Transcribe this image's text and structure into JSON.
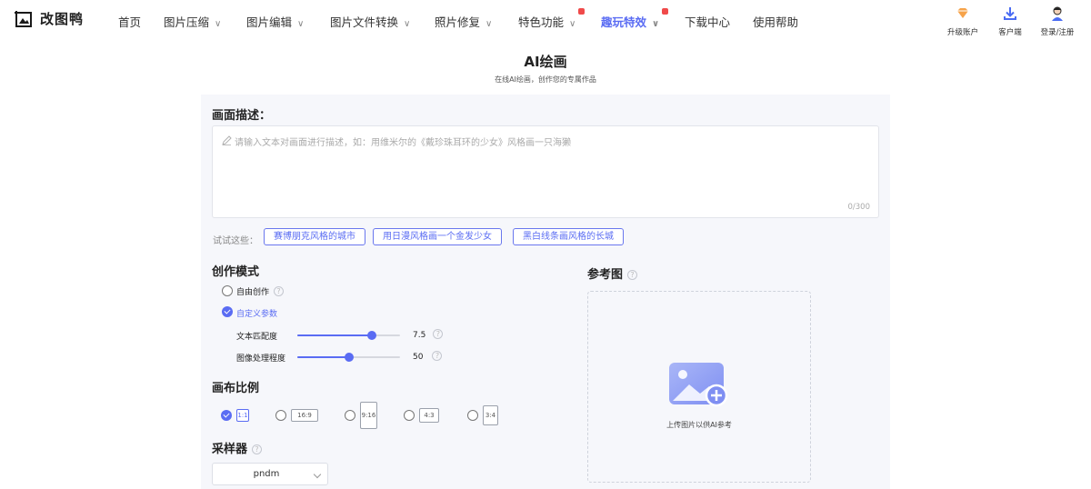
{
  "brand": {
    "name": "改图鸭"
  },
  "nav": [
    {
      "label": "首页",
      "dropdown": false,
      "active": false,
      "dot": false
    },
    {
      "label": "图片压缩",
      "dropdown": true,
      "active": false,
      "dot": false
    },
    {
      "label": "图片编辑",
      "dropdown": true,
      "active": false,
      "dot": false
    },
    {
      "label": "图片文件转换",
      "dropdown": true,
      "active": false,
      "dot": false
    },
    {
      "label": "照片修复",
      "dropdown": true,
      "active": false,
      "dot": false
    },
    {
      "label": "特色功能",
      "dropdown": true,
      "active": false,
      "dot": true
    },
    {
      "label": "趣玩特效",
      "dropdown": true,
      "active": true,
      "dot": true
    },
    {
      "label": "下载中心",
      "dropdown": false,
      "active": false,
      "dot": false
    },
    {
      "label": "使用帮助",
      "dropdown": false,
      "active": false,
      "dot": false
    }
  ],
  "tools": [
    {
      "label": "升级账户",
      "icon": "diamond-icon"
    },
    {
      "label": "客户端",
      "icon": "download-icon"
    },
    {
      "label": "登录/注册",
      "icon": "user-avatar-icon"
    }
  ],
  "page": {
    "title": "AI绘画",
    "subtitle": "在线AI绘画，创作您的专属作品"
  },
  "description": {
    "title": "画面描述：",
    "placeholder": "请输入文本对画面进行描述，如：用维米尔的《戴珍珠耳环的少女》风格画一只海獭",
    "value": "",
    "counter": "0/300"
  },
  "suggestions": {
    "label": "试试这些：",
    "chips": [
      "赛博朋克风格的城市",
      "用日漫风格画一个金发少女",
      "黑白线条画风格的长城"
    ]
  },
  "mode": {
    "title": "创作模式",
    "options": [
      {
        "label": "自由创作",
        "selected": false
      },
      {
        "label": "自定义参数",
        "selected": true
      }
    ],
    "sliders": [
      {
        "label": "文本匹配度",
        "value": "7.5",
        "fraction": 0.73
      },
      {
        "label": "图像处理程度",
        "value": "50",
        "fraction": 0.5
      }
    ]
  },
  "ratio": {
    "title": "画布比例",
    "options": [
      {
        "label": "1:1",
        "selected": true
      },
      {
        "label": "16:9",
        "selected": false
      },
      {
        "label": "9:16",
        "selected": false
      },
      {
        "label": "4:3",
        "selected": false
      },
      {
        "label": "3:4",
        "selected": false
      }
    ]
  },
  "sampler": {
    "title": "采样器",
    "value": "pndm"
  },
  "reference": {
    "title": "参考图",
    "upload_text": "上传图片以供AI参考"
  },
  "colors": {
    "accent": "#5a6cf3",
    "panel_bg": "#f6f7fb"
  }
}
